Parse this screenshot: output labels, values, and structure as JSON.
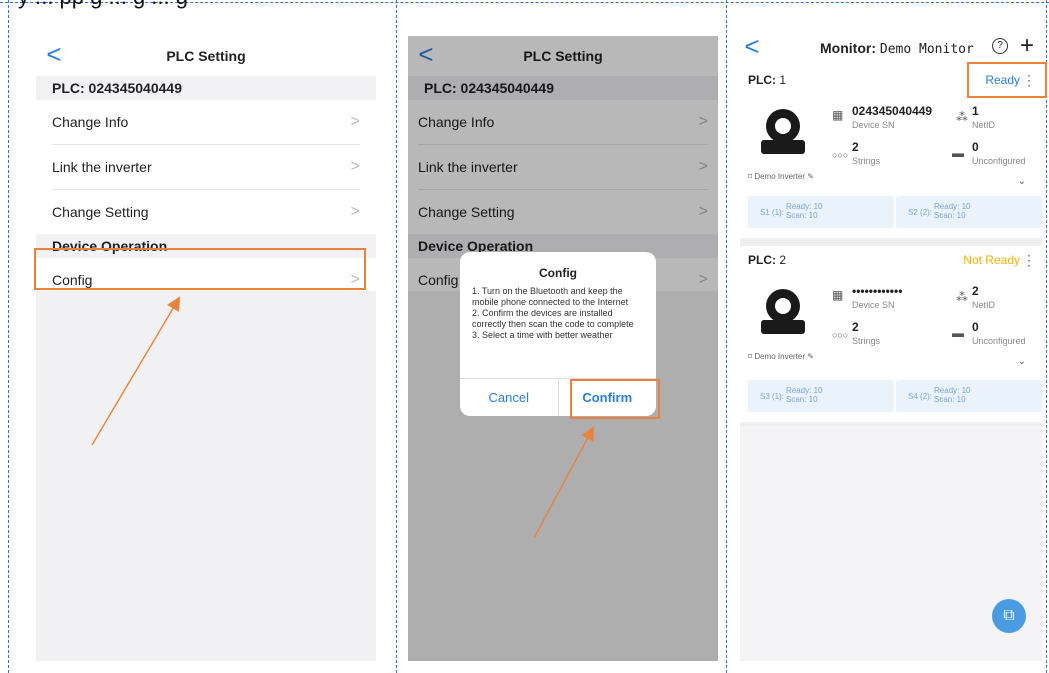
{
  "top_text": "y ... pp g ... g ... g",
  "panel1": {
    "title": "PLC Setting",
    "plc_label": "PLC: 024345040449",
    "rows": [
      "Change Info",
      "Link the inverter",
      "Change Setting"
    ],
    "section2": "Device Operation",
    "row_config": "Config",
    "chevron": ">",
    "back": "<"
  },
  "panel2": {
    "title": "PLC Setting",
    "plc_label": "PLC: 024345040449",
    "rows": [
      "Change Info",
      "Link the inverter",
      "Change Setting"
    ],
    "section2": "Device Operation",
    "row_config": "Config",
    "dialog": {
      "title": "Config",
      "lines": [
        "1. Turn on the Bluetooth and keep the mobile phone connected to the Internet",
        "2. Confirm the devices are installed correctly then scan the code to complete",
        "3. Select a time with better weather"
      ],
      "cancel": "Cancel",
      "confirm": "Confirm"
    }
  },
  "panel3": {
    "title_prefix": "Monitor:",
    "title_name": "Demo Monitor",
    "plcs": [
      {
        "label": "PLC:",
        "num": "1",
        "status": "Ready",
        "status_color": "#2a7ce0",
        "sn": "024345040449",
        "sn_label": "Device SN",
        "netid": "1",
        "netid_label": "NetID",
        "strings": "2",
        "strings_label": "Strings",
        "unconfigured": "0",
        "unconfigured_label": "Unconfigured",
        "inverter": "Demo Inverter",
        "pills": [
          {
            "key": "S1 (1):",
            "r1": "Ready: 10",
            "r2": "Scan: 10"
          },
          {
            "key": "S2 (2):",
            "r1": "Ready: 10",
            "r2": "Scan: 10"
          }
        ]
      },
      {
        "label": "PLC:",
        "num": "2",
        "status": "Not Ready",
        "status_color": "#f3b400",
        "sn": "••••••••••••",
        "sn_label": "Device SN",
        "netid": "2",
        "netid_label": "NetID",
        "strings": "2",
        "strings_label": "Strings",
        "unconfigured": "0",
        "unconfigured_label": "Unconfigured",
        "inverter": "Demo Inverter",
        "pills": [
          {
            "key": "S3 (1):",
            "r1": "Ready: 10",
            "r2": "Scan: 10"
          },
          {
            "key": "S4 (2):",
            "r1": "Ready: 10",
            "r2": "Scan: 10"
          }
        ]
      }
    ]
  },
  "colors": {
    "accent": "#2a7ce0",
    "highlight": "#e8823c",
    "arrow": "#e8823c"
  }
}
